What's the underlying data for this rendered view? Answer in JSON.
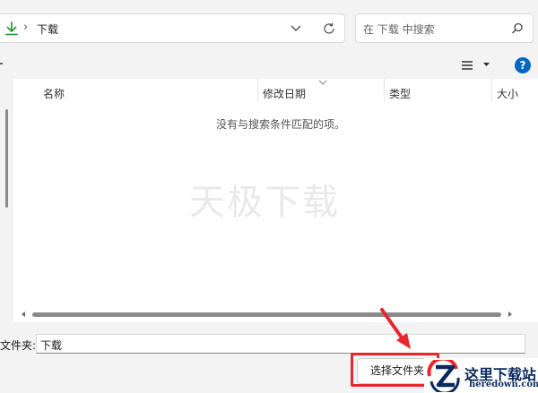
{
  "address": {
    "current_folder": "下载",
    "separator": "›"
  },
  "search": {
    "placeholder": "在 下载 中搜索"
  },
  "toolbar": {
    "help_label": "?"
  },
  "columns": [
    "名称",
    "修改日期",
    "类型",
    "大小"
  ],
  "empty_message": "没有与搜索条件匹配的项。",
  "watermark": "天极下载",
  "footer": {
    "folder_label": "文件夹:",
    "folder_value": "下载",
    "select_button": "选择文件夹"
  },
  "logo": {
    "name": "这里下载站",
    "domain": "heredown.com"
  },
  "colors": {
    "accent": "#0067c0",
    "download_green": "#2e9b3a",
    "highlight_red": "#e8262b"
  }
}
